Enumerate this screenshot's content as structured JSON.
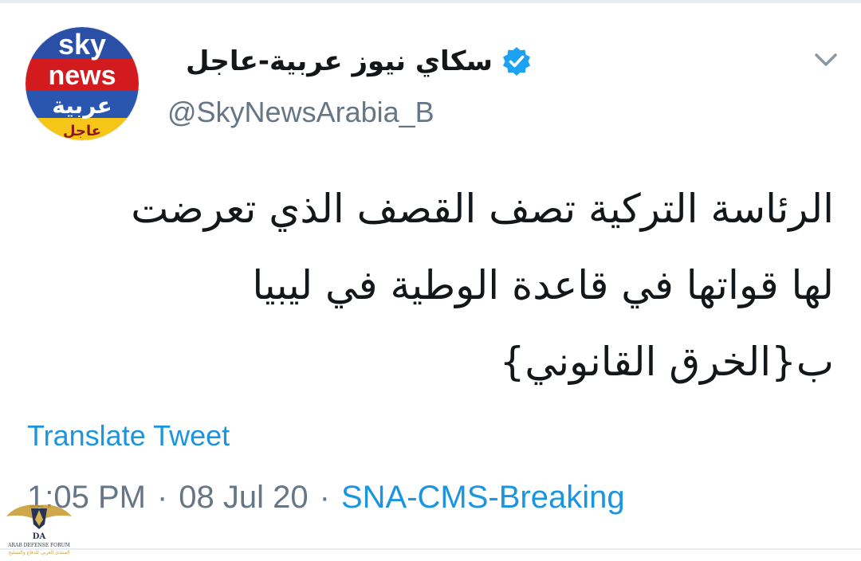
{
  "tweet": {
    "display_name": "سكاي نيوز عربية-عاجل",
    "handle": "@SkyNewsArabia_B",
    "text_lines": [
      "الرئاسة التركية تصف القصف الذي تعرضت",
      "لها قواتها في قاعدة الوطية في ليبيا",
      "ب{الخرق القانوني}"
    ],
    "translate_label": "Translate Tweet",
    "time": "1:05 PM",
    "separator": "·",
    "date": "08 Jul 20",
    "source": "SNA-CMS-Breaking"
  },
  "avatar": {
    "line1": "sky",
    "line2": "news",
    "line3": "عربية",
    "line4": "عاجل"
  },
  "watermark": {
    "monogram": "DA",
    "name": "ARAB DEFENSE FORUM",
    "tagline": "المنتدى العربي للدفاع والتسليح"
  },
  "icons": {
    "verified": "verified-badge-icon",
    "menu": "chevron-down-icon"
  },
  "colors": {
    "link": "#1b95e0",
    "muted": "#657786",
    "text": "#14171a",
    "verified": "#1da1f2",
    "avatar_blue": "#1f4fa3",
    "avatar_red": "#d21a1f",
    "avatar_yellow": "#f5c518"
  }
}
